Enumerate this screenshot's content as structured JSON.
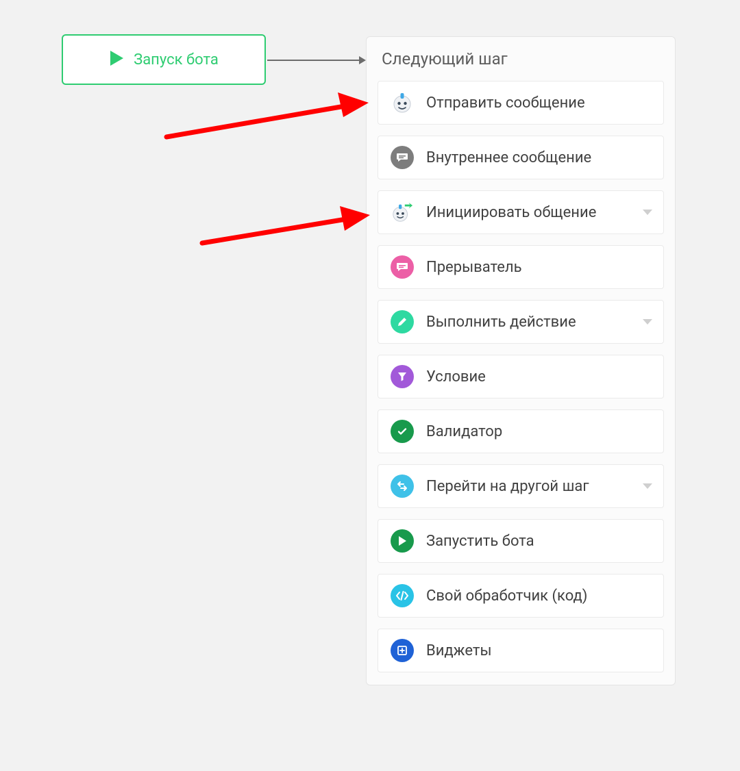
{
  "start": {
    "label": "Запуск бота"
  },
  "panel": {
    "title": "Следующий шаг",
    "options": [
      {
        "id": "send-message",
        "label": "Отправить сообщение",
        "icon": "robot-icon",
        "has_caret": false
      },
      {
        "id": "internal-message",
        "label": "Внутреннее сообщение",
        "icon": "message-grey-icon",
        "has_caret": false
      },
      {
        "id": "initiate-chat",
        "label": "Инициировать общение",
        "icon": "robot-arrow-icon",
        "has_caret": true
      },
      {
        "id": "breaker",
        "label": "Прерыватель",
        "icon": "message-pink-icon",
        "has_caret": false
      },
      {
        "id": "run-action",
        "label": "Выполнить действие",
        "icon": "pencil-green-icon",
        "has_caret": true
      },
      {
        "id": "condition",
        "label": "Условие",
        "icon": "funnel-purple-icon",
        "has_caret": false
      },
      {
        "id": "validator",
        "label": "Валидатор",
        "icon": "check-green-icon",
        "has_caret": false
      },
      {
        "id": "goto-step",
        "label": "Перейти на другой шаг",
        "icon": "arrows-blue-icon",
        "has_caret": true
      },
      {
        "id": "run-bot",
        "label": "Запустить бота",
        "icon": "play-green-icon",
        "has_caret": false
      },
      {
        "id": "custom-handler",
        "label": "Свой обработчик (код)",
        "icon": "code-cyan-icon",
        "has_caret": false
      },
      {
        "id": "widgets",
        "label": "Виджеты",
        "icon": "widget-blue-icon",
        "has_caret": false
      }
    ]
  },
  "colors": {
    "accent_green": "#2ecc71",
    "grey": "#7d7d7d",
    "pink": "#ec5fa6",
    "mint": "#2ed9a1",
    "purple": "#a259d9",
    "dark_green": "#189a4c",
    "sky": "#3fc1e8",
    "cyan": "#29c3e6",
    "blue": "#1f62d6",
    "annotation_red": "#ff0000"
  }
}
